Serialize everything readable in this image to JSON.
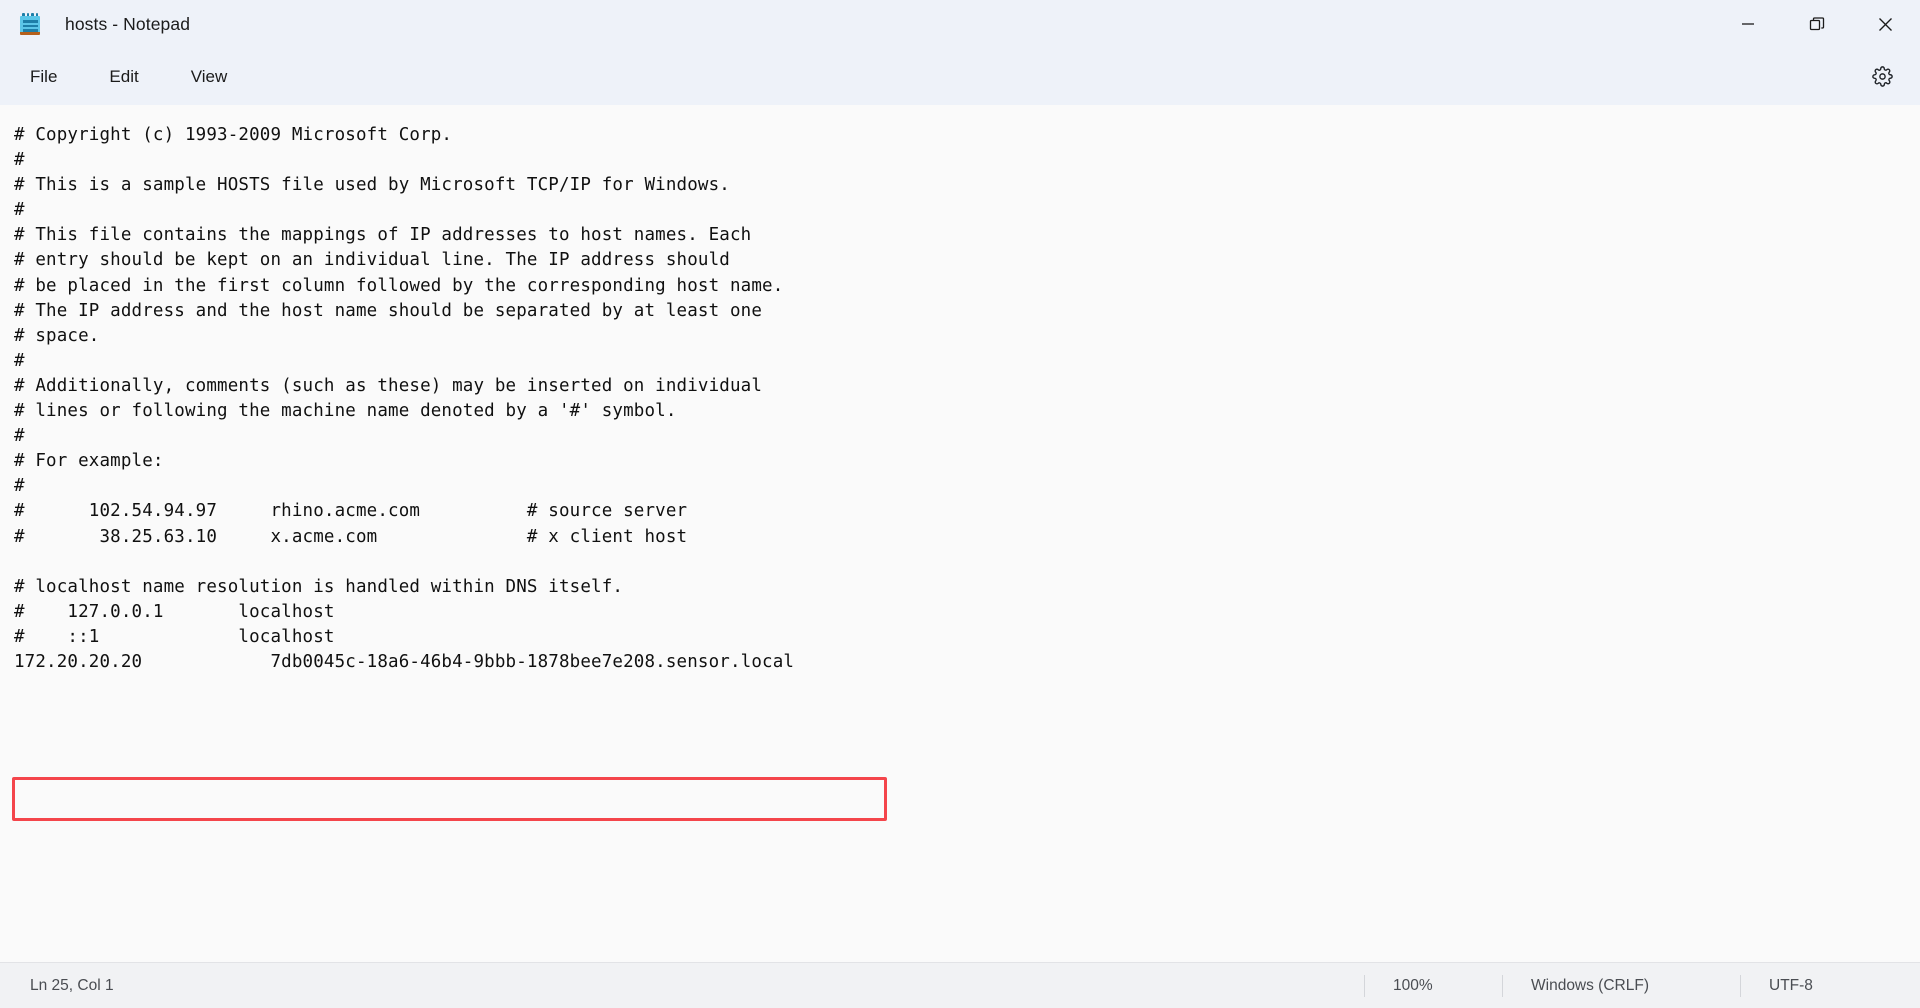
{
  "window": {
    "title": "hosts - Notepad",
    "app_icon": "notepad-icon",
    "controls": {
      "minimize": "minimize-icon",
      "restore": "restore-icon",
      "close": "close-icon"
    }
  },
  "menubar": {
    "items": [
      {
        "label": "File"
      },
      {
        "label": "Edit"
      },
      {
        "label": "View"
      }
    ],
    "settings_icon": "gear-icon"
  },
  "editor": {
    "lines": [
      "# Copyright (c) 1993-2009 Microsoft Corp.",
      "#",
      "# This is a sample HOSTS file used by Microsoft TCP/IP for Windows.",
      "#",
      "# This file contains the mappings of IP addresses to host names. Each",
      "# entry should be kept on an individual line. The IP address should",
      "# be placed in the first column followed by the corresponding host name.",
      "# The IP address and the host name should be separated by at least one",
      "# space.",
      "#",
      "# Additionally, comments (such as these) may be inserted on individual",
      "# lines or following the machine name denoted by a '#' symbol.",
      "#",
      "# For example:",
      "#",
      "#      102.54.94.97     rhino.acme.com          # source server",
      "#       38.25.63.10     x.acme.com              # x client host",
      "",
      "# localhost name resolution is handled within DNS itself.",
      "#    127.0.0.1       localhost",
      "#    ::1             localhost",
      "172.20.20.20            7db0045c-18a6-46b4-9bbb-1878bee7e208.sensor.local"
    ],
    "highlighted_line": {
      "ip": "172.20.20.20",
      "hostname": "7db0045c-18a6-46b4-9bbb-1878bee7e208.sensor.local",
      "border_color": "#f4454b"
    }
  },
  "statusbar": {
    "cursor_position": "Ln 25, Col 1",
    "zoom": "100%",
    "line_endings": "Windows (CRLF)",
    "encoding": "UTF-8"
  },
  "colors": {
    "titlebar_bg": "#eef2f9",
    "editor_bg": "#fafafa",
    "statusbar_bg": "#f1f2f4",
    "text": "#101010",
    "highlight": "#f4454b"
  }
}
